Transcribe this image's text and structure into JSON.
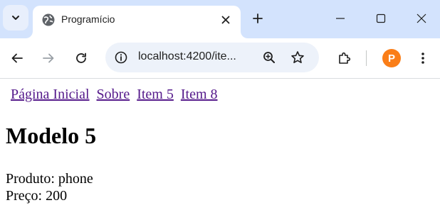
{
  "browser": {
    "tab": {
      "title": "Programício"
    },
    "address_bar": {
      "url": "localhost:4200/ite..."
    },
    "profile_initial": "P",
    "colors": {
      "tabstrip": "#d3e3fd",
      "omnibox": "#edf2fa",
      "profile": "#fa7e18"
    },
    "icons": {
      "tab_search": "chevron-down-icon",
      "favicon": "globe-icon",
      "tab_close": "close-icon",
      "new_tab": "plus-icon",
      "minimize": "minimize-icon",
      "maximize": "maximize-icon",
      "window_close": "close-icon",
      "back": "back-arrow-icon",
      "forward": "forward-arrow-icon",
      "reload": "reload-icon",
      "site_info": "info-icon",
      "zoom": "zoom-icon",
      "bookmark": "star-icon",
      "extensions": "puzzle-icon",
      "menu": "kebab-menu-icon"
    }
  },
  "page": {
    "nav": {
      "links": [
        "Página Inicial",
        "Sobre",
        "Item 5",
        "Item 8"
      ],
      "link_color": "#551a8b"
    },
    "title": "Modelo 5",
    "product_line": "Produto: phone",
    "price_line": "Preço: 200"
  }
}
